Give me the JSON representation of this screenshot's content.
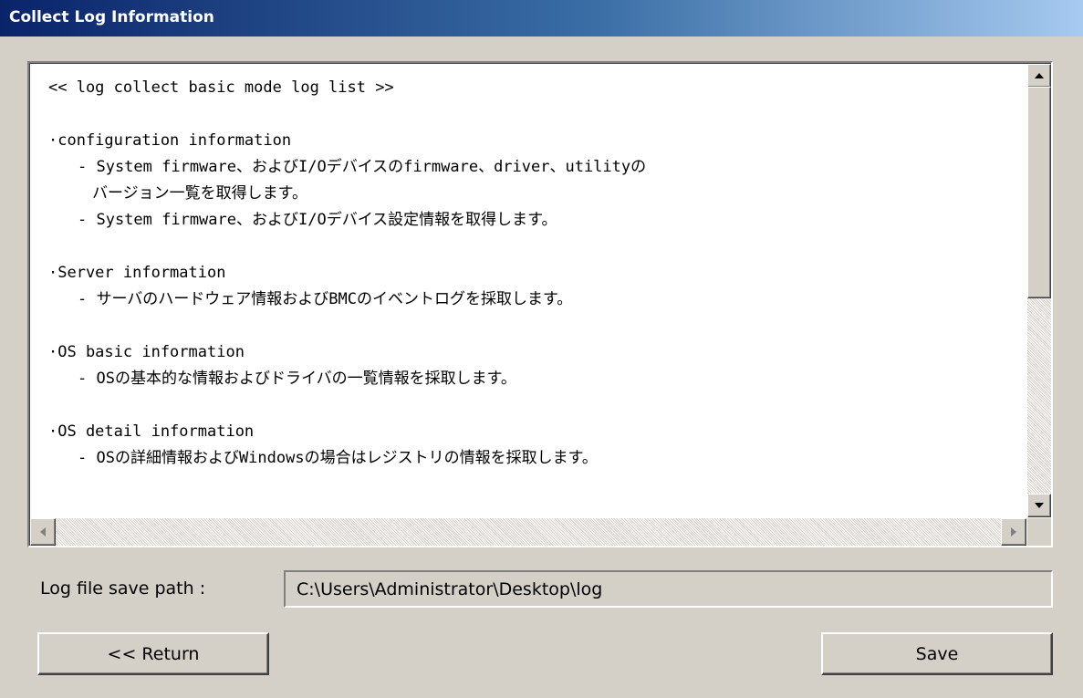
{
  "window": {
    "title": "Collect Log Information",
    "title_gradient": [
      "#0a246a",
      "#a6caf0"
    ],
    "background": "#d4d0c8"
  },
  "log": {
    "header": "<< log collect basic mode log list >>",
    "sections": [
      {
        "title": "·configuration information",
        "lines": [
          "- System firmware、およびI/Oデバイスのfirmware、driver、utilityの",
          "バージョン一覧を取得します。",
          "- System firmware、およびI/Oデバイス設定情報を取得します。"
        ]
      },
      {
        "title": "·Server information",
        "lines": [
          "- サーバのハードウェア情報およびBMCのイベントログを採取します。"
        ]
      },
      {
        "title": "·OS basic information",
        "lines": [
          "- OSの基本的な情報およびドライバの一覧情報を採取します。"
        ]
      },
      {
        "title": "·OS detail information",
        "lines": [
          "- OSの詳細情報およびWindowsの場合はレジストリの情報を採取します。"
        ]
      }
    ]
  },
  "form": {
    "path_label": "Log file save path :",
    "path_value": "C:\\Users\\Administrator\\Desktop\\log"
  },
  "buttons": {
    "return_label": "<< Return",
    "save_label": "Save"
  },
  "icons": {
    "scroll_up": "triangle-up-icon",
    "scroll_down": "triangle-down-icon",
    "scroll_left": "triangle-left-icon",
    "scroll_right": "triangle-right-icon"
  }
}
